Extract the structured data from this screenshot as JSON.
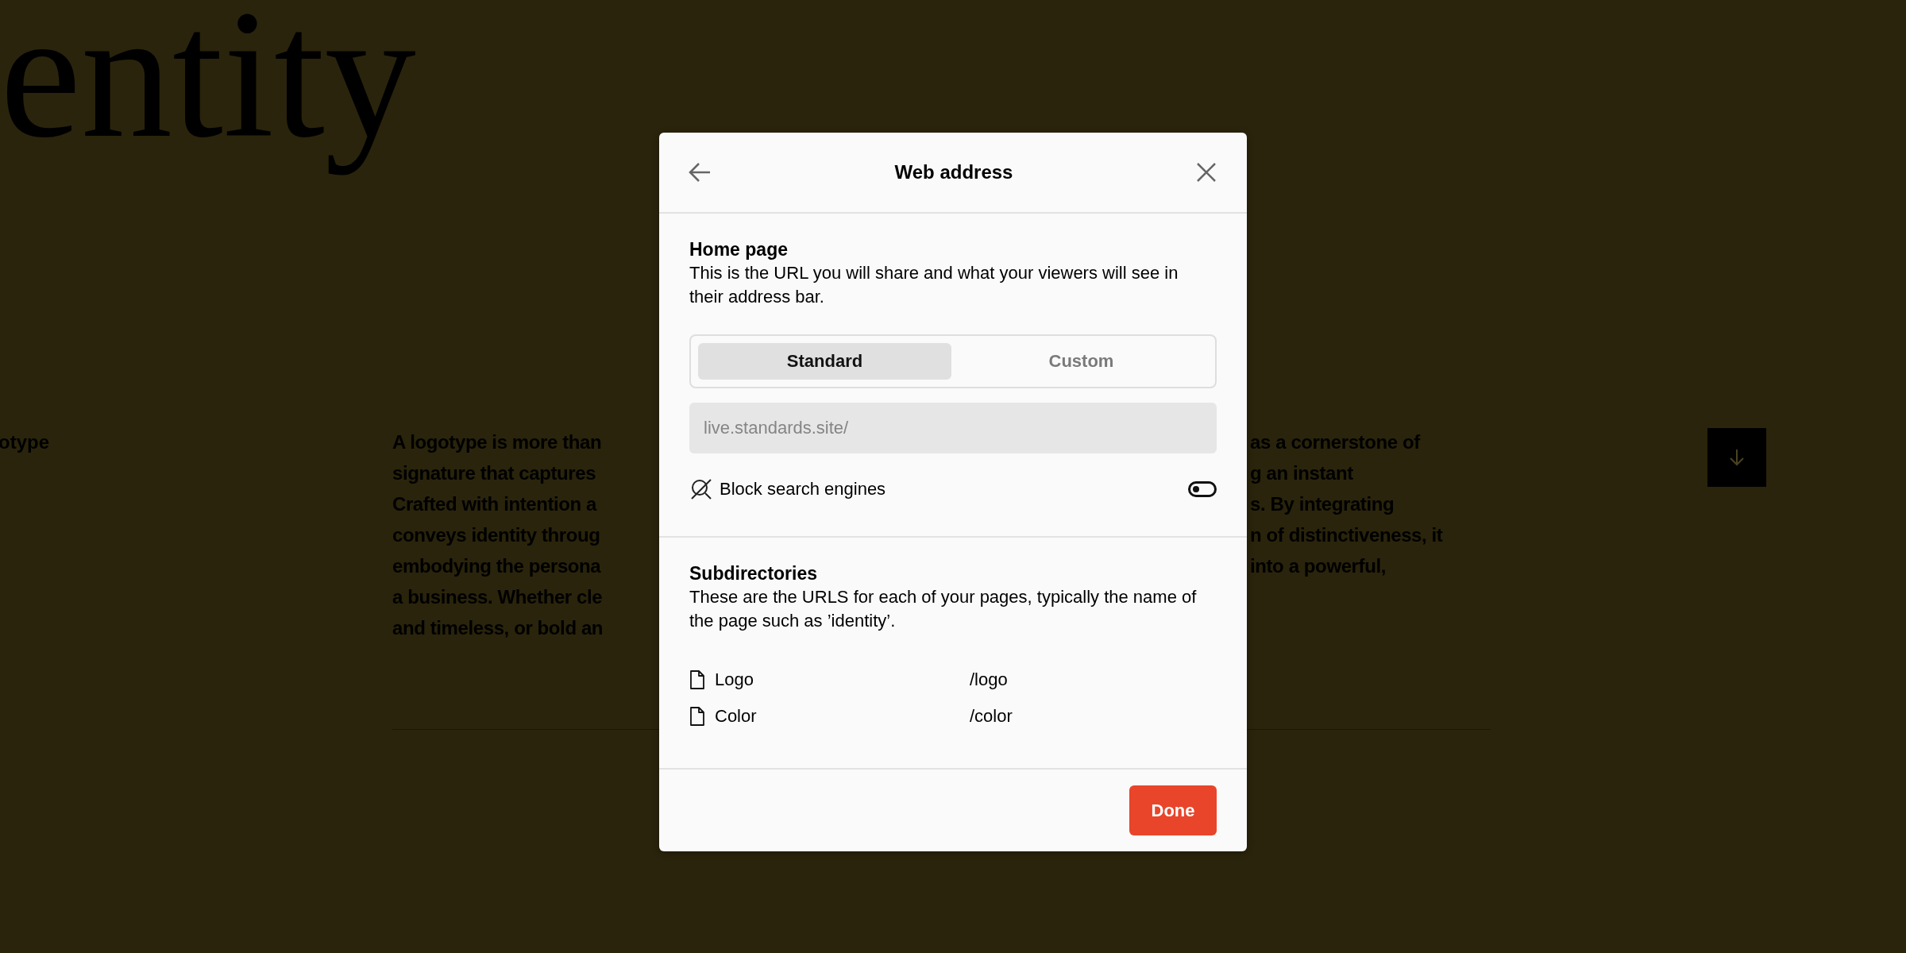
{
  "background": {
    "heading": "entity",
    "section_label": "otype",
    "paragraph_left": [
      "A logotype is more than",
      "signature that captures",
      "Crafted with intention a",
      "conveys identity throug",
      "embodying the persona",
      "a business. Whether cle",
      "and timeless, or bold an"
    ],
    "paragraph_right": [
      "as a cornerstone of",
      "g an instant",
      "s. By integrating",
      "n of distinctiveness, it",
      "into a powerful,"
    ]
  },
  "dialog": {
    "title": "Web address",
    "home_page": {
      "heading": "Home page",
      "description": "This is the URL you will share and what your viewers will see in their address bar.",
      "segments": [
        {
          "label": "Standard",
          "selected": true
        },
        {
          "label": "Custom",
          "selected": false
        }
      ],
      "url_field": {
        "placeholder": "live.standards.site/"
      },
      "block_search_engines": {
        "label": "Block search engines",
        "on": false
      }
    },
    "subdirectories": {
      "heading": "Subdirectories",
      "description": "These are the URLS for each of your pages, typically the name of the page such as ’identity’.",
      "pages": [
        {
          "name": "Logo",
          "path": "/logo"
        },
        {
          "name": "Color",
          "path": "/color"
        }
      ]
    },
    "done_button": "Done"
  }
}
